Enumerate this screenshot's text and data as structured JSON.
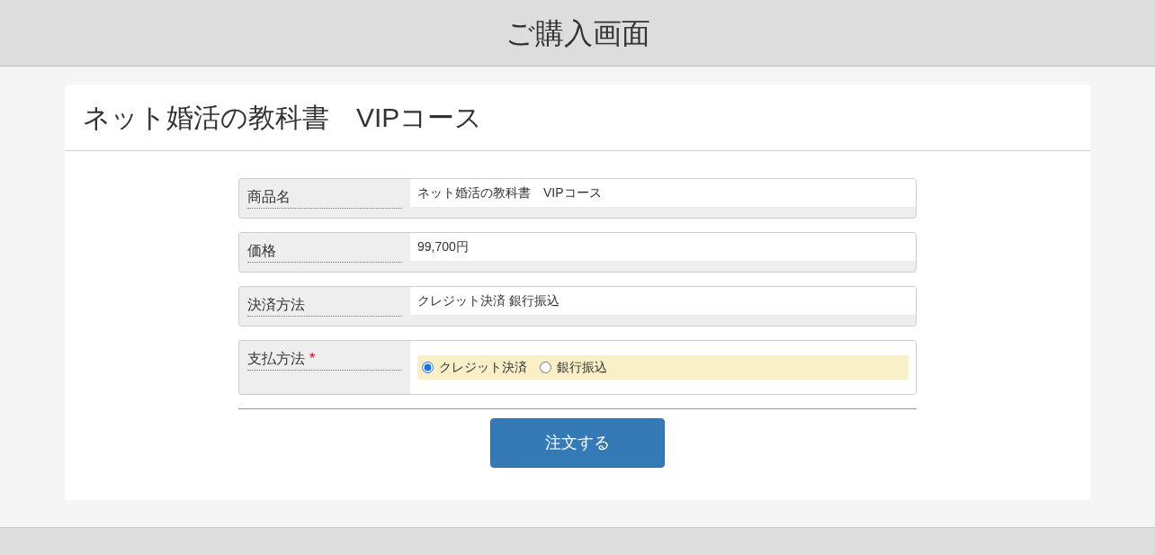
{
  "header": {
    "title": "ご購入画面"
  },
  "card": {
    "title": "ネット婚活の教科書　VIPコース"
  },
  "fields": [
    {
      "kind": "text",
      "label": "商品名",
      "value": "ネット婚活の教科書　VIPコース"
    },
    {
      "kind": "text",
      "label": "価格",
      "value": "99,700円"
    },
    {
      "kind": "text",
      "label": "決済方法",
      "value": "クレジット決済 銀行振込"
    },
    {
      "kind": "radio",
      "label": "支払方法",
      "required_mark": "*",
      "options": [
        {
          "label": "クレジット決済",
          "selected": true
        },
        {
          "label": "銀行振込",
          "selected": false
        }
      ]
    }
  ],
  "submit": {
    "label": "注文する"
  }
}
